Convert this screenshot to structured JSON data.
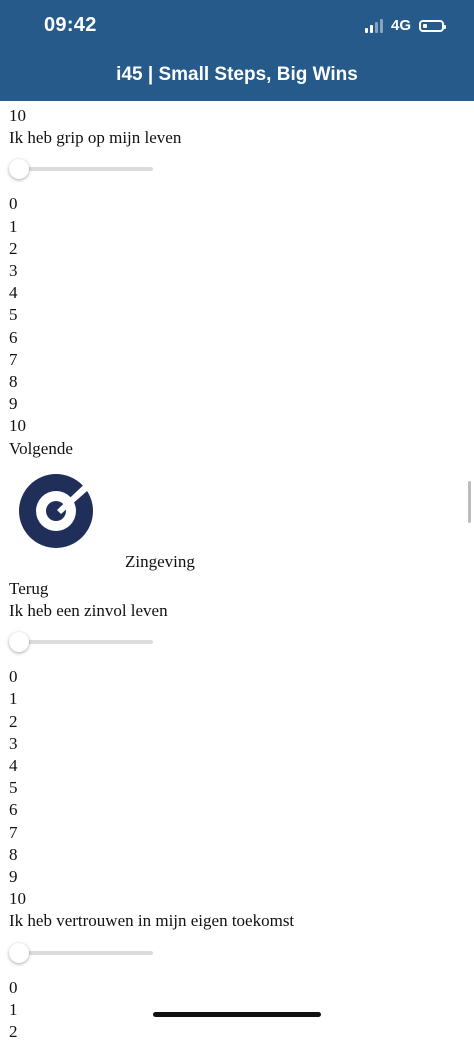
{
  "status": {
    "time": "09:42",
    "network": "4G"
  },
  "header": {
    "title": "i45 | Small Steps, Big Wins"
  },
  "section1": {
    "last_value": "10",
    "question": "Ik heb grip op mijn leven",
    "slider_value": 0,
    "options": [
      "0",
      "1",
      "2",
      "3",
      "4",
      "5",
      "6",
      "7",
      "8",
      "9",
      "10"
    ],
    "next_label": "Volgende"
  },
  "section2": {
    "title": "Zingeving",
    "back_label": "Terug",
    "question": "Ik heb een zinvol leven",
    "slider_value": 0,
    "options": [
      "0",
      "1",
      "2",
      "3",
      "4",
      "5",
      "6",
      "7",
      "8",
      "9",
      "10"
    ]
  },
  "section3": {
    "question": "Ik heb vertrouwen in mijn eigen toekomst",
    "slider_value": 0,
    "options": [
      "0",
      "1",
      "2"
    ]
  },
  "colors": {
    "header_bg": "#255a8a",
    "logo_navy": "#1f2f5a"
  }
}
